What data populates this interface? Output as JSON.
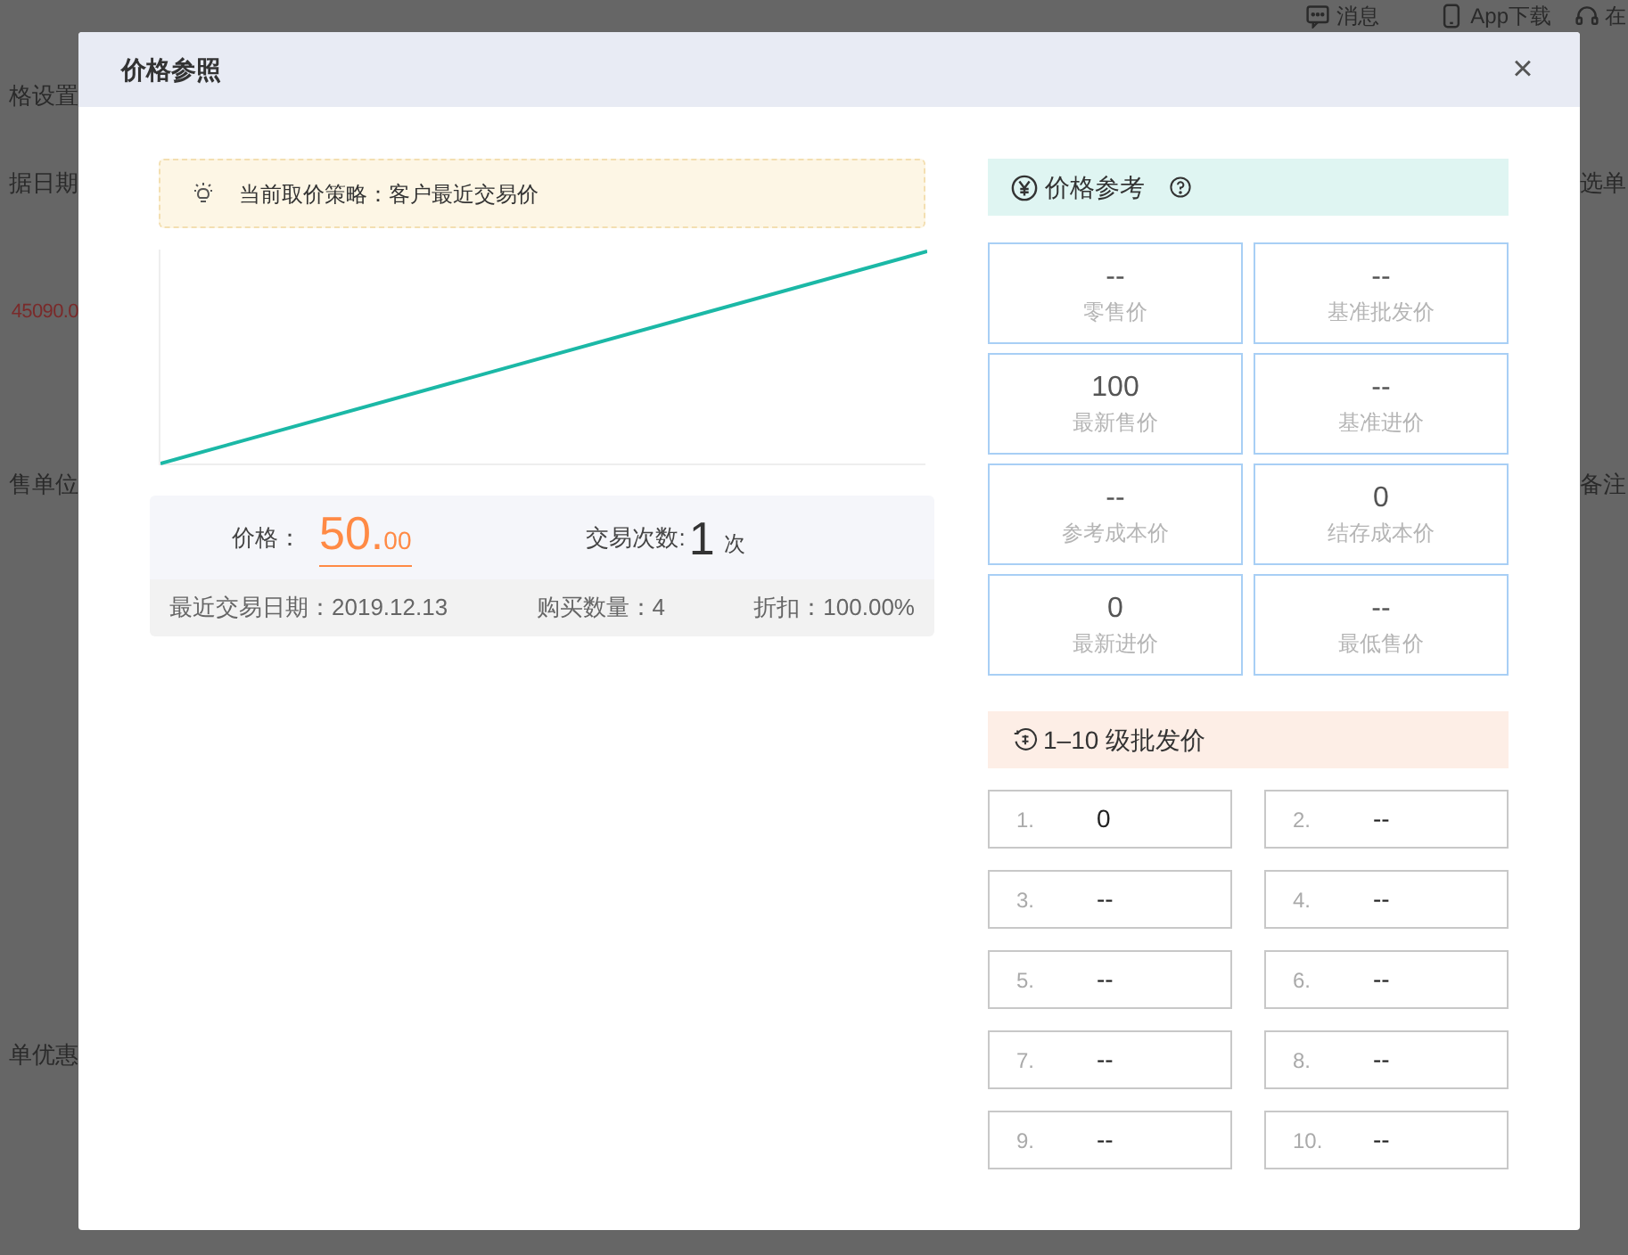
{
  "background": {
    "topbar": [
      {
        "kind": "message",
        "label": "消息"
      },
      {
        "kind": "phone",
        "label": "App下载"
      },
      {
        "kind": "headset",
        "label": "在"
      }
    ],
    "left_items": [
      {
        "text": "格设置",
        "kind": "plain"
      },
      {
        "text": "据日期",
        "kind": "plain"
      },
      {
        "text": "45090.0",
        "kind": "amount"
      },
      {
        "text": "售单位",
        "kind": "plain"
      },
      {
        "text": "单优惠",
        "kind": "plain"
      }
    ],
    "right_items": [
      "选单",
      "备注"
    ]
  },
  "dialog": {
    "title": "价格参照",
    "close": "×",
    "tip": "当前取价策略：客户最近交易价",
    "summary": {
      "price_label": "价格：",
      "price_integer": "50.",
      "price_decimal": "00",
      "count_label": "交易次数:",
      "count": "1",
      "count_unit": "次",
      "details": [
        "最近交易日期：2019.12.13",
        "购买数量：4",
        "折扣：100.00%"
      ]
    },
    "reference": {
      "title": "价格参考",
      "cells": [
        {
          "value": "--",
          "label": "零售价"
        },
        {
          "value": "--",
          "label": "基准批发价"
        },
        {
          "value": "100",
          "label": "最新售价"
        },
        {
          "value": "--",
          "label": "基准进价"
        },
        {
          "value": "--",
          "label": "参考成本价"
        },
        {
          "value": "0",
          "label": "结存成本价"
        },
        {
          "value": "0",
          "label": "最新进价"
        },
        {
          "value": "--",
          "label": "最低售价"
        }
      ]
    },
    "tiers": {
      "title": "1–10 级批发价",
      "items": [
        {
          "index": "1.",
          "value": "0"
        },
        {
          "index": "2.",
          "value": "--"
        },
        {
          "index": "3.",
          "value": "--"
        },
        {
          "index": "4.",
          "value": "--"
        },
        {
          "index": "5.",
          "value": "--"
        },
        {
          "index": "6.",
          "value": "--"
        },
        {
          "index": "7.",
          "value": "--"
        },
        {
          "index": "8.",
          "value": "--"
        },
        {
          "index": "9.",
          "value": "--"
        },
        {
          "index": "10.",
          "value": "--"
        }
      ]
    }
  }
}
